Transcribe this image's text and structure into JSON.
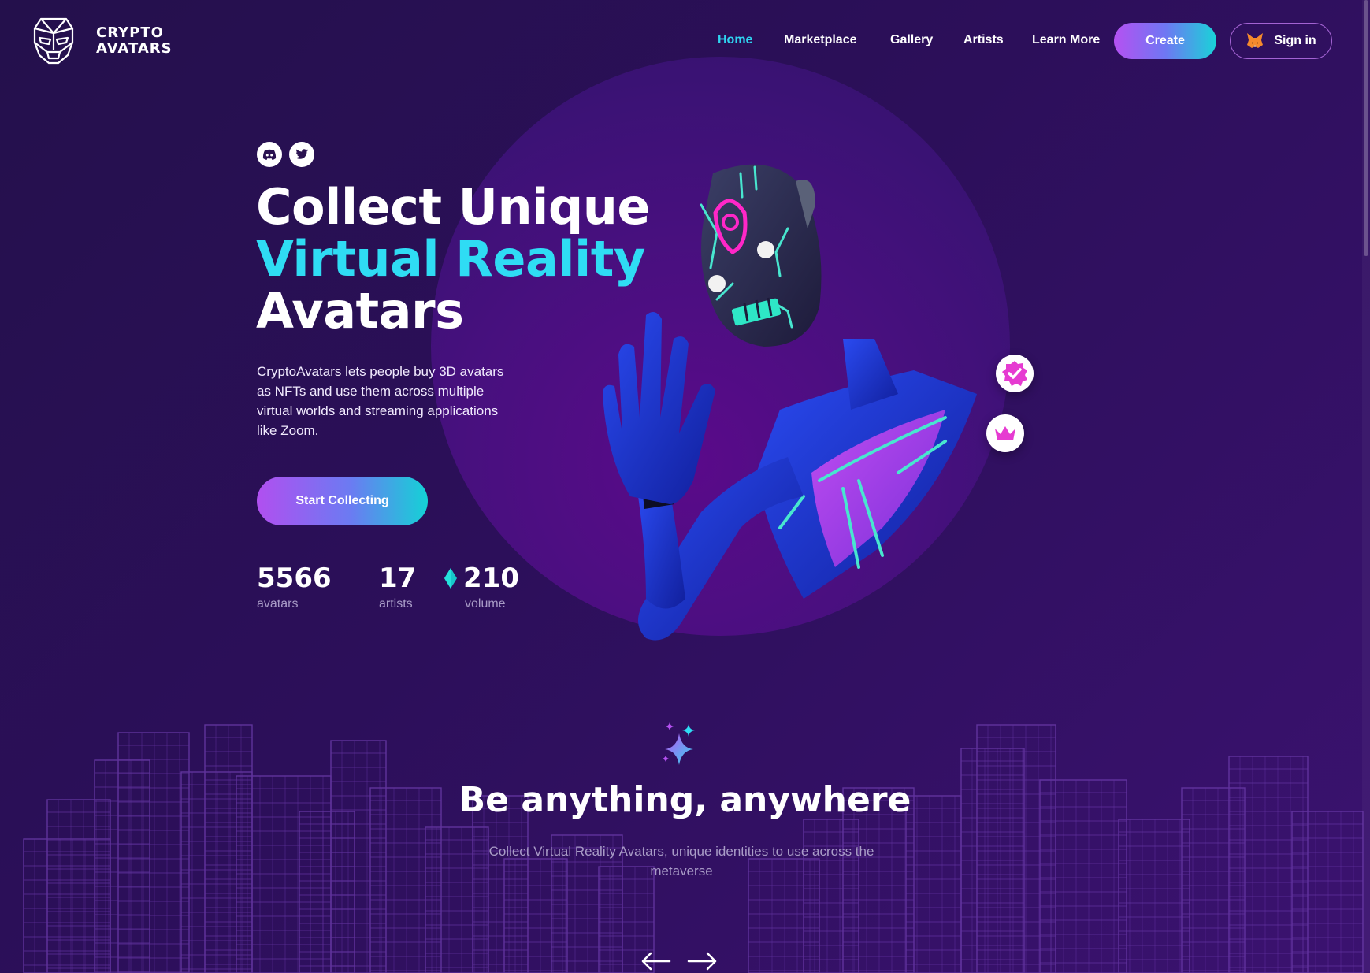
{
  "brand": {
    "line1": "CRYPTO",
    "line2": "AVATARS"
  },
  "nav": {
    "items": [
      {
        "label": "Home",
        "active": true
      },
      {
        "label": "Marketplace",
        "active": false
      },
      {
        "label": "Gallery",
        "active": false
      },
      {
        "label": "Artists",
        "active": false
      },
      {
        "label": "Learn More",
        "active": false
      }
    ],
    "create_label": "Create",
    "signin_label": "Sign in"
  },
  "social": {
    "icons": [
      "discord-icon",
      "twitter-icon"
    ]
  },
  "hero": {
    "title_line1": "Collect Unique",
    "title_line2": "Virtual Reality",
    "title_line3": "Avatars",
    "description": "CryptoAvatars lets people buy 3D avatars as NFTs and use them across multiple virtual worlds and streaming applications like Zoom.",
    "cta_label": "Start Collecting"
  },
  "stats": [
    {
      "value": "5566",
      "label": "avatars"
    },
    {
      "value": "17",
      "label": "artists"
    },
    {
      "value": "210",
      "label": "volume",
      "icon": "ethereum-icon"
    }
  ],
  "badges": [
    "verified-icon",
    "crown-icon"
  ],
  "section": {
    "title": "Be anything, anywhere",
    "subtitle": "Collect Virtual Reality Avatars, unique identities to use across the metaverse",
    "icons": [
      "sparkle-icon",
      "arrow-left-icon",
      "arrow-right-icon"
    ]
  },
  "colors": {
    "background": "#2c0f5a",
    "accent_cyan": "#2fd4f0",
    "accent_purple": "#b551f2",
    "muted_text": "#a99cc7"
  }
}
